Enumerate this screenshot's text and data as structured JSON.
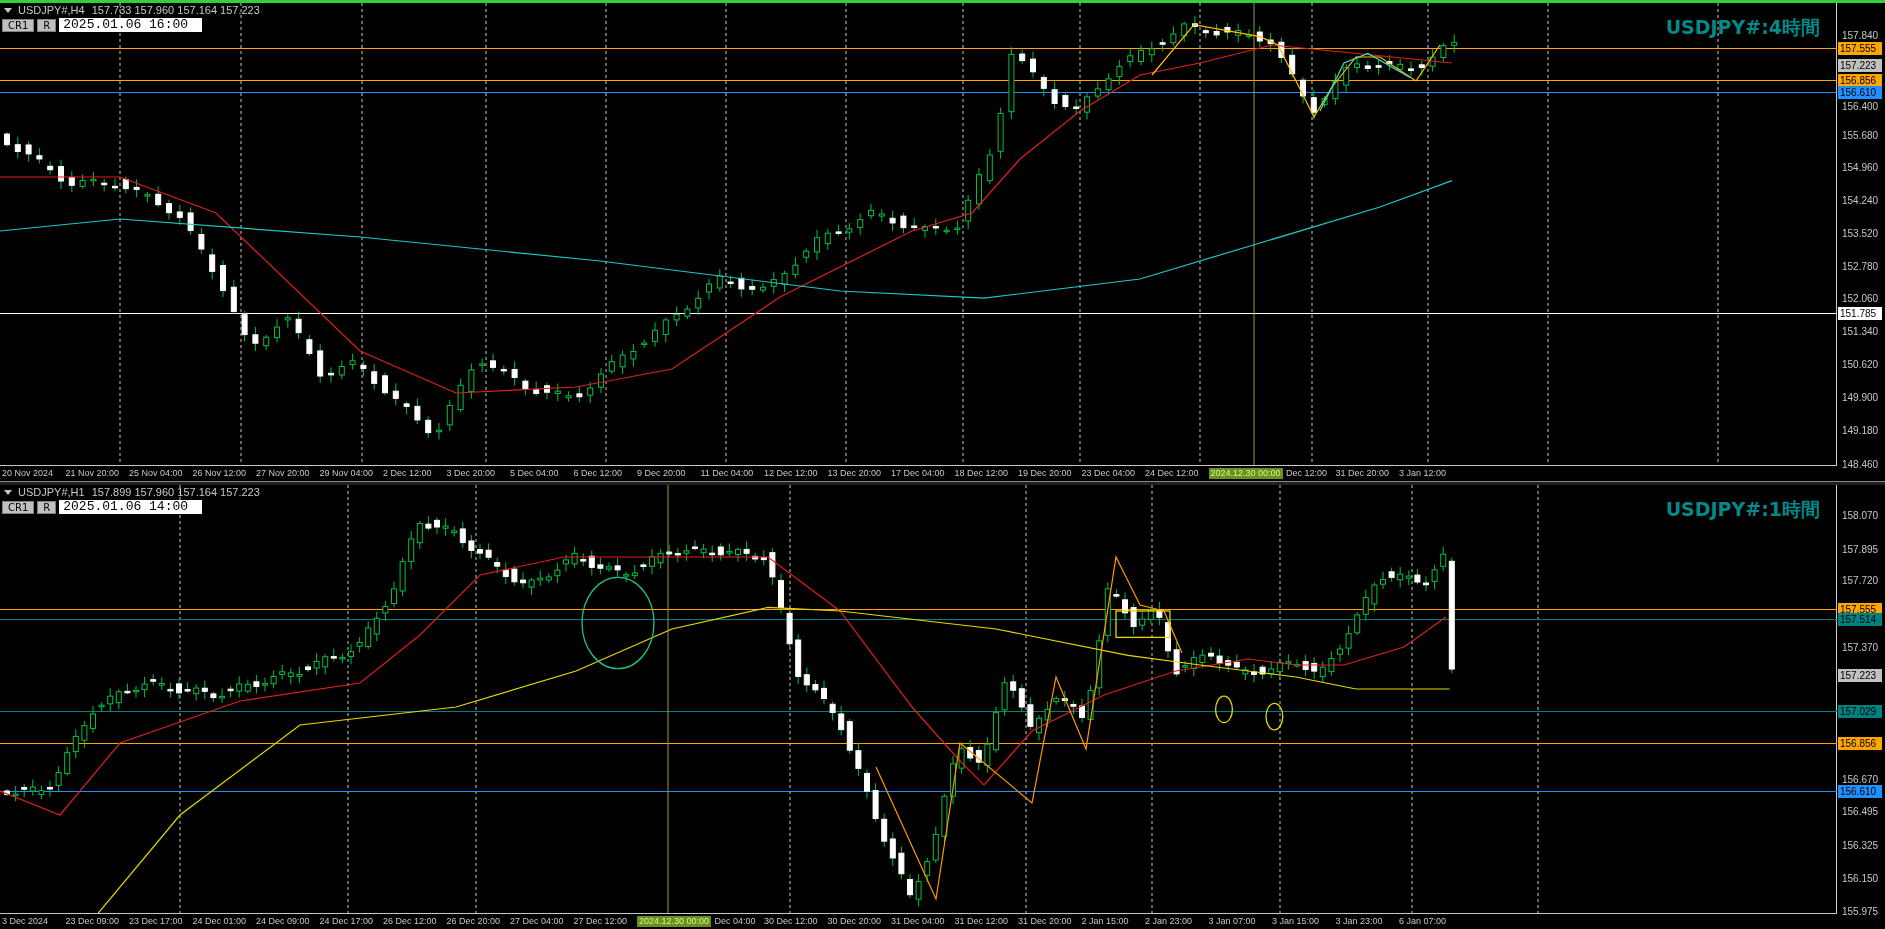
{
  "charts": [
    {
      "selected": true,
      "symbol": "USDJPY#,H4",
      "ohlc": "157.733 157.960 157.164 157.223",
      "buttons": [
        "CR1",
        "R"
      ],
      "date": "2025.01.06 16:00",
      "title": "USDJPY#:4時間",
      "price_labels": [
        "157.840",
        "156.400",
        "155.680",
        "154.960",
        "154.240",
        "153.520",
        "152.780",
        "152.060",
        "151.340",
        "150.620",
        "149.900",
        "149.180",
        "148.460"
      ],
      "price_tags": [
        {
          "text": "157.555",
          "color": "#ffa500",
          "kind": "level"
        },
        {
          "text": "157.223",
          "color": "#c0c0c0",
          "kind": "bid"
        },
        {
          "text": "156.856",
          "color": "#ffa500",
          "kind": "level"
        },
        {
          "text": "156.610",
          "color": "#1e90ff",
          "kind": "level"
        },
        {
          "text": "151.785",
          "color": "#ffffff",
          "kind": "level"
        }
      ],
      "time_labels": [
        {
          "text": "20 Nov 2024",
          "kind": "tick"
        },
        {
          "text": "21 Nov 20:00",
          "kind": "tick"
        },
        {
          "text": "25 Nov 04:00",
          "kind": "tick"
        },
        {
          "text": "26 Nov 12:00",
          "kind": "tick"
        },
        {
          "text": "27 Nov 20:00",
          "kind": "tick"
        },
        {
          "text": "29 Nov 04:00",
          "kind": "tick"
        },
        {
          "text": "2 Dec 12:00",
          "kind": "tick"
        },
        {
          "text": "3 Dec 20:00",
          "kind": "tick"
        },
        {
          "text": "5 Dec 04:00",
          "kind": "tick"
        },
        {
          "text": "6 Dec 12:00",
          "kind": "tick"
        },
        {
          "text": "9 Dec 20:00",
          "kind": "tick"
        },
        {
          "text": "11 Dec 04:00",
          "kind": "tick"
        },
        {
          "text": "12 Dec 12:00",
          "kind": "tick"
        },
        {
          "text": "13 Dec 20:00",
          "kind": "tick"
        },
        {
          "text": "17 Dec 04:00",
          "kind": "tick"
        },
        {
          "text": "18 Dec 12:00",
          "kind": "tick"
        },
        {
          "text": "19 Dec 20:00",
          "kind": "tick"
        },
        {
          "text": "23 Dec 04:00",
          "kind": "tick"
        },
        {
          "text": "24 Dec 12:00",
          "kind": "tick"
        },
        {
          "text": "2024.12.30 00:00",
          "kind": "cursor"
        },
        {
          "text": "Dec 12:00",
          "kind": "tick"
        },
        {
          "text": "31 Dec 20:00",
          "kind": "tick"
        },
        {
          "text": "3 Jan 12:00",
          "kind": "tick"
        }
      ]
    },
    {
      "selected": false,
      "symbol": "USDJPY#,H1",
      "ohlc": "157.899 157.960 157.164 157.223",
      "buttons": [
        "CR1",
        "R"
      ],
      "date": "2025.01.06 14:00",
      "title": "USDJPY#:1時間",
      "price_labels": [
        "158.070",
        "157.895",
        "157.720",
        "157.370",
        "156.670",
        "156.495",
        "156.325",
        "156.150",
        "155.975"
      ],
      "price_tags": [
        {
          "text": "157.555",
          "color": "#ffa500",
          "kind": "level"
        },
        {
          "text": "157.514",
          "color": "#008080",
          "kind": "level"
        },
        {
          "text": "157.223",
          "color": "#c0c0c0",
          "kind": "bid"
        },
        {
          "text": "157.029",
          "color": "#008080",
          "kind": "level"
        },
        {
          "text": "156.856",
          "color": "#ffa500",
          "kind": "level"
        },
        {
          "text": "156.610",
          "color": "#1e90ff",
          "kind": "level"
        }
      ],
      "time_labels": [
        {
          "text": "3 Dec 2024",
          "kind": "tick"
        },
        {
          "text": "23 Dec 09:00",
          "kind": "tick"
        },
        {
          "text": "23 Dec 17:00",
          "kind": "tick"
        },
        {
          "text": "24 Dec 01:00",
          "kind": "tick"
        },
        {
          "text": "24 Dec 09:00",
          "kind": "tick"
        },
        {
          "text": "24 Dec 17:00",
          "kind": "tick"
        },
        {
          "text": "26 Dec 12:00",
          "kind": "tick"
        },
        {
          "text": "26 Dec 20:00",
          "kind": "tick"
        },
        {
          "text": "27 Dec 04:00",
          "kind": "tick"
        },
        {
          "text": "27 Dec 12:00",
          "kind": "tick"
        },
        {
          "text": "2024.12.30 00:00",
          "kind": "cursor"
        },
        {
          "text": "Dec 04:00",
          "kind": "tick"
        },
        {
          "text": "30 Dec 12:00",
          "kind": "tick"
        },
        {
          "text": "30 Dec 20:00",
          "kind": "tick"
        },
        {
          "text": "31 Dec 04:00",
          "kind": "tick"
        },
        {
          "text": "31 Dec 12:00",
          "kind": "tick"
        },
        {
          "text": "31 Dec 20:00",
          "kind": "tick"
        },
        {
          "text": "2 Jan 15:00",
          "kind": "tick"
        },
        {
          "text": "2 Jan 23:00",
          "kind": "tick"
        },
        {
          "text": "3 Jan 07:00",
          "kind": "tick"
        },
        {
          "text": "3 Jan 15:00",
          "kind": "tick"
        },
        {
          "text": "3 Jan 23:00",
          "kind": "tick"
        },
        {
          "text": "6 Jan 07:00",
          "kind": "tick"
        }
      ]
    }
  ]
}
